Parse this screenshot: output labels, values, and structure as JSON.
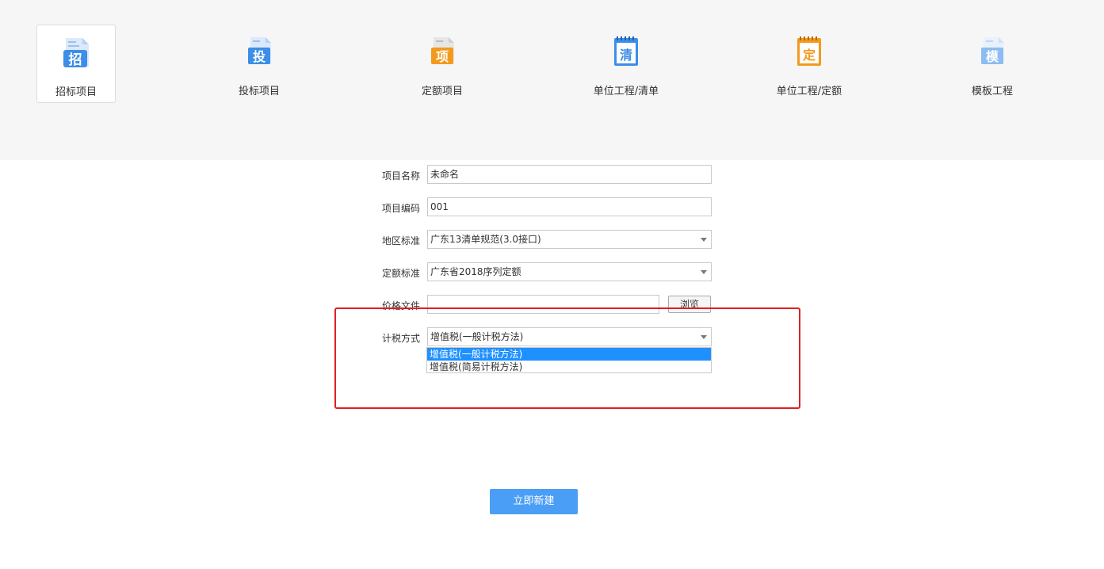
{
  "colors": {
    "accent": "#4a9ef5",
    "selection": "#1e90ff",
    "highlight": "#e02020"
  },
  "templates": [
    {
      "label": "招标项目",
      "glyph": "招",
      "icon": "zhao-icon",
      "color": "#3c8ee8"
    },
    {
      "label": "投标项目",
      "glyph": "投",
      "icon": "tou-icon",
      "color": "#3c8ee8"
    },
    {
      "label": "定额项目",
      "glyph": "项",
      "icon": "xiang-icon",
      "color": "#f39a1e"
    },
    {
      "label": "单位工程/清单",
      "glyph": "清",
      "icon": "qing-icon",
      "color": "#3c8ee8"
    },
    {
      "label": "单位工程/定额",
      "glyph": "定",
      "icon": "ding-icon",
      "color": "#f39a1e"
    },
    {
      "label": "模板工程",
      "glyph": "模",
      "icon": "mo-icon",
      "color": "#8cbcf0"
    }
  ],
  "form": {
    "project_name": {
      "label": "项目名称",
      "value": "未命名"
    },
    "project_code": {
      "label": "项目编码",
      "value": "001"
    },
    "region_standard": {
      "label": "地区标准",
      "value": "广东13清单规范(3.0接口)"
    },
    "quota_standard": {
      "label": "定额标准",
      "value": "广东省2018序列定额"
    },
    "price_file": {
      "label": "价格文件",
      "value": "",
      "browse_label": "浏览"
    },
    "tax_method": {
      "label": "计税方式",
      "value": "增值税(一般计税方法)",
      "options": [
        "增值税(一般计税方法)",
        "增值税(简易计税方法)"
      ]
    }
  },
  "create_button": "立即新建"
}
